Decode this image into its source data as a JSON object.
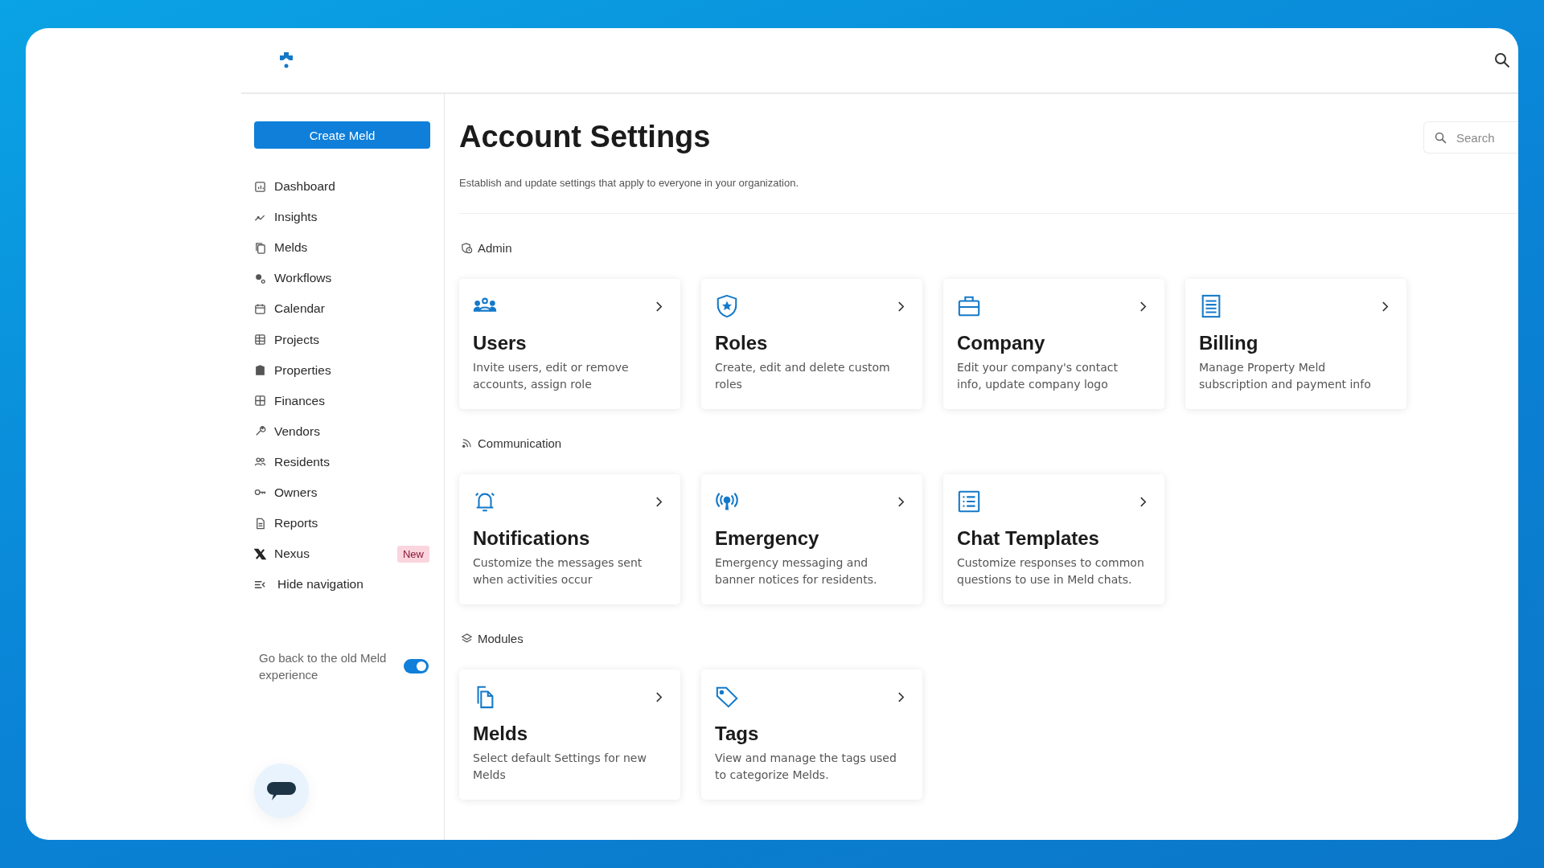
{
  "sidebar": {
    "create_button": "Create Meld",
    "items": [
      {
        "label": "Dashboard"
      },
      {
        "label": "Insights"
      },
      {
        "label": "Melds"
      },
      {
        "label": "Workflows"
      },
      {
        "label": "Calendar"
      },
      {
        "label": "Projects"
      },
      {
        "label": "Properties"
      },
      {
        "label": "Finances"
      },
      {
        "label": "Vendors"
      },
      {
        "label": "Residents"
      },
      {
        "label": "Owners"
      },
      {
        "label": "Reports"
      },
      {
        "label": "Nexus",
        "badge": "New"
      }
    ],
    "hide_navigation": "Hide navigation",
    "legacy_toggle": {
      "label": "Go back to the old Meld experience",
      "on": true
    }
  },
  "page": {
    "title": "Account Settings",
    "subtitle": "Establish and update settings that apply to everyone in your organization.",
    "search": {
      "placeholder": "Search"
    },
    "sections": [
      {
        "title": "Admin",
        "cards": [
          {
            "title": "Users",
            "description": "Invite users, edit or remove accounts, assign role"
          },
          {
            "title": "Roles",
            "description": "Create, edit and delete custom roles"
          },
          {
            "title": "Company",
            "description": "Edit your company's contact info, update company logo"
          },
          {
            "title": "Billing",
            "description": "Manage Property Meld subscription and payment info"
          }
        ]
      },
      {
        "title": "Communication",
        "cards": [
          {
            "title": "Notifications",
            "description": "Customize the messages sent when activities occur"
          },
          {
            "title": "Emergency",
            "description": "Emergency messaging and banner notices for residents."
          },
          {
            "title": "Chat Templates",
            "description": "Customize responses to common questions to use in Meld chats."
          }
        ]
      },
      {
        "title": "Modules",
        "cards": [
          {
            "title": "Melds",
            "description": "Select default Settings for new Melds"
          },
          {
            "title": "Tags",
            "description": "View and manage the tags used to categorize Melds."
          }
        ]
      }
    ]
  }
}
